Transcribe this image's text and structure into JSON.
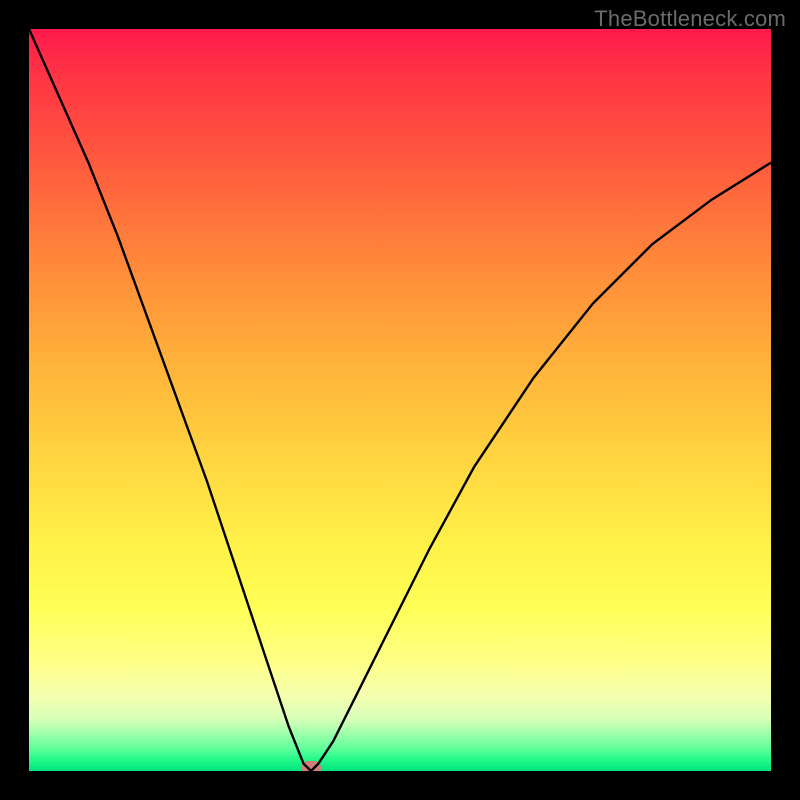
{
  "watermark": "TheBottleneck.com",
  "chart_data": {
    "type": "line",
    "title": "",
    "xlabel": "",
    "ylabel": "",
    "xlim": [
      0,
      100
    ],
    "ylim": [
      0,
      100
    ],
    "notes": "V-shaped bottleneck curve over a vertical red→green gradient. Minimum (optimal point) near x≈38, y≈0, marked by a small pill. Axes and tick labels are not shown.",
    "series": [
      {
        "name": "bottleneck-curve",
        "x": [
          0,
          4,
          8,
          12,
          16,
          20,
          24,
          28,
          32,
          35,
          37,
          38,
          39,
          41,
          44,
          48,
          54,
          60,
          68,
          76,
          84,
          92,
          100
        ],
        "values": [
          100,
          91,
          82,
          72,
          61,
          50,
          39,
          27,
          15,
          6,
          1,
          0,
          1,
          4,
          10,
          18,
          30,
          41,
          53,
          63,
          71,
          77,
          82
        ]
      }
    ],
    "marker": {
      "x": 38,
      "y": 0
    },
    "gradient_stops": [
      {
        "pct": 0,
        "color": "#ff1a4d"
      },
      {
        "pct": 50,
        "color": "#ffd540"
      },
      {
        "pct": 80,
        "color": "#ffff57"
      },
      {
        "pct": 100,
        "color": "#00e47e"
      }
    ]
  }
}
